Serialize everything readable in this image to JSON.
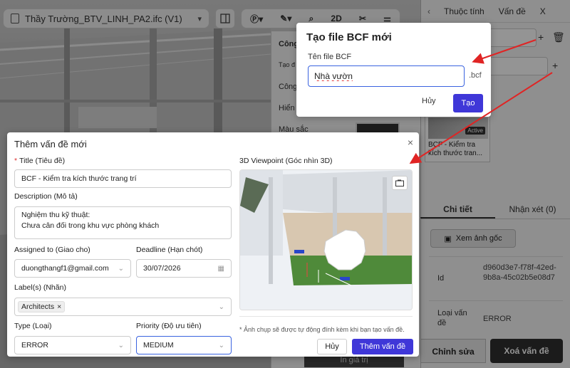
{
  "toolbar": {
    "file_name": "Thầy Trường_BTV_LINH_PA2.ifc (V1)",
    "btn_2d": "2D"
  },
  "prop_panel": {
    "rows": [
      "Công",
      "Tạo đ",
      "Công",
      "Hiển",
      "Màu sắc"
    ],
    "bottom_button": "In giá trị"
  },
  "right_panel": {
    "tabs": [
      "Thuộc tính",
      "Vấn đề",
      "X"
    ],
    "card": {
      "active_badge": "Active",
      "text": "BCF - Kiểm tra kích thước tran..."
    },
    "subtabs": [
      "Chi tiết",
      "Nhận xét (0)"
    ],
    "view_original": "Xem ảnh gốc",
    "details": [
      {
        "key": "Id",
        "value": "d960d3e7-f78f-42ed-9b8a-45c02b5e08d7"
      },
      {
        "key": "Loại vấn đề",
        "value": "ERROR"
      }
    ],
    "edit_button": "Chỉnh sửa",
    "delete_button": "Xoá vấn đề"
  },
  "bcf_dialog": {
    "title": "Tạo file BCF mới",
    "label": "Tên file BCF",
    "value": "Nhà vườn",
    "extension": ".bcf",
    "cancel": "Hủy",
    "create": "Tạo"
  },
  "issue_dialog": {
    "title": "Thêm vấn đề mới",
    "title_label": "Title (Tiêu đề)",
    "title_value": "BCF - Kiểm tra kích thước trang trí",
    "description_label": "Description (Mô tả)",
    "description_line1": "Nghiệm thu kỹ thuật:",
    "description_line2": "Chưa cân đối trong khu vực phòng khách",
    "assigned_label": "Assigned to (Giao cho)",
    "assigned_value": "duongthangf1@gmail.com",
    "deadline_label": "Deadline (Hạn chót)",
    "deadline_value": "30/07/2026",
    "labels_label": "Label(s) (Nhãn)",
    "label_chip": "Architects",
    "type_label": "Type (Loại)",
    "type_value": "ERROR",
    "priority_label": "Priority (Độ ưu tiên)",
    "priority_value": "MEDIUM",
    "viewpoint_label": "3D Viewpoint (Góc nhìn 3D)",
    "viewpoint_note": "* Ảnh chụp sẽ được tự động đính kèm khi bạn tạo vấn đề.",
    "cancel": "Hủy",
    "submit": "Thêm vấn đề"
  },
  "colors": {
    "accent": "#3f37d8",
    "focus": "#3a63e0",
    "annotation": "#e02424"
  }
}
